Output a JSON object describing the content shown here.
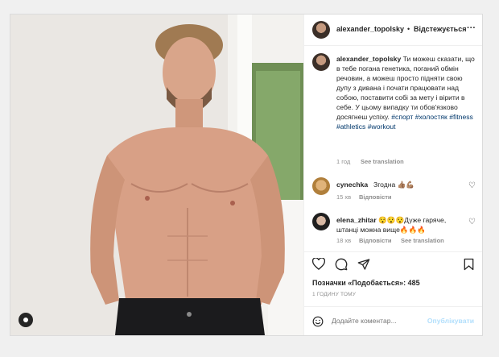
{
  "post": {
    "username": "alexander_topolsky",
    "separator": "•",
    "follow_label": "Відстежується",
    "more_label": "···"
  },
  "caption": {
    "username": "alexander_topolsky",
    "text": "Ти можеш сказати, що в тебе погана генетика, поганий обмін речовин, а можеш просто підняти свою дупу з дивана і почати працювати над собою, поставити собі за мету і вірити в себе. У цьому випадку ти обов'язково досягнеш успіху.",
    "tags": [
      "#спорт",
      "#холостяк",
      "#fitness",
      "#athletics",
      "#workout"
    ],
    "time": "1 год",
    "see_translation": "See translation"
  },
  "comments": [
    {
      "username": "cynechka",
      "text": "Згодна 👍🏽💪🏽",
      "time": "15 хв",
      "reply": "Відповісти",
      "see_translation": ""
    },
    {
      "username": "elena_zhitar",
      "text": "😯😯😯Дуже гаряче, штанці можна вище🔥🔥🔥",
      "time": "18 хв",
      "reply": "Відповісти",
      "see_translation": "See translation"
    }
  ],
  "actions": {
    "like_icon": "heart-icon",
    "comment_icon": "comment-icon",
    "share_icon": "share-icon",
    "save_icon": "bookmark-icon"
  },
  "likes_text": "Позначки «Подобається»: 485",
  "post_time": "1 ГОДИНУ ТОМУ",
  "comment_box": {
    "placeholder": "Додайте коментар...",
    "publish_label": "Опублікувати",
    "emoji_icon": "smiley-icon"
  },
  "colors": {
    "link": "#00376b",
    "publish": "#b2dffc",
    "border": "#dbdbdb"
  }
}
